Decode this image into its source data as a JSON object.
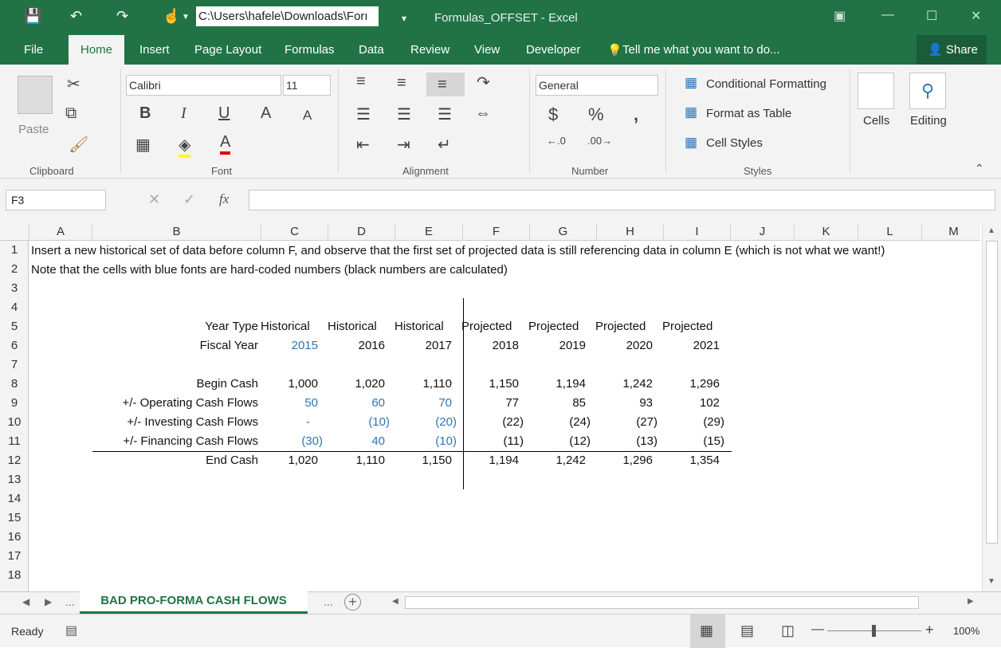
{
  "title_bar": {
    "path": "C:\\Users\\hafele\\Downloads\\Forı",
    "window_title": "Formulas_OFFSET - Excel"
  },
  "tabs": [
    "File",
    "Home",
    "Insert",
    "Page Layout",
    "Formulas",
    "Data",
    "Review",
    "View",
    "Developer"
  ],
  "tell_me": "Tell me what you want to do...",
  "share": "Share",
  "ribbon": {
    "paste": "Paste",
    "font_name": "Calibri",
    "font_size": "11",
    "number_format": "General",
    "conditional_formatting": "Conditional Formatting",
    "format_as_table": "Format as Table",
    "cell_styles": "Cell Styles",
    "cells": "Cells",
    "editing": "Editing",
    "groups": {
      "clipboard": "Clipboard",
      "font": "Font",
      "alignment": "Alignment",
      "number": "Number",
      "styles": "Styles"
    }
  },
  "formula_bar": {
    "name_box": "F3",
    "fx": "fx",
    "formula": ""
  },
  "columns": [
    "A",
    "B",
    "C",
    "D",
    "E",
    "F",
    "G",
    "H",
    "I",
    "J",
    "K",
    "L",
    "M"
  ],
  "rows": [
    "1",
    "2",
    "3",
    "4",
    "5",
    "6",
    "7",
    "8",
    "9",
    "10",
    "11",
    "12",
    "13",
    "14",
    "15",
    "16",
    "17",
    "18"
  ],
  "sheet": {
    "note1": "Insert a new historical set of data before column F, and observe that the first set of projected data is still referencing data in column E (which is not what we want!)",
    "note2": "Note that the cells with blue fonts are hard-coded numbers (black numbers are calculated)",
    "year_type_label": "Year Type",
    "year_types": [
      "Historical",
      "Historical",
      "Historical",
      "Projected",
      "Projected",
      "Projected",
      "Projected"
    ],
    "fiscal_year_label": "Fiscal Year",
    "fiscal_years": [
      "2015",
      "2016",
      "2017",
      "2018",
      "2019",
      "2020",
      "2021"
    ],
    "begin_cash_label": "Begin Cash",
    "begin_cash": [
      "1,000",
      "1,020",
      "1,110",
      "1,150",
      "1,194",
      "1,242",
      "1,296"
    ],
    "operating_label": "+/- Operating Cash Flows",
    "operating": [
      "50",
      "60",
      "70",
      "77",
      "85",
      "93",
      "102"
    ],
    "investing_label": "+/- Investing Cash Flows",
    "investing": [
      "-",
      "(10)",
      "(20)",
      "(22)",
      "(24)",
      "(27)",
      "(29)"
    ],
    "financing_label": "+/- Financing Cash Flows",
    "financing": [
      "(30)",
      "40",
      "(10)",
      "(11)",
      "(12)",
      "(13)",
      "(15)"
    ],
    "end_cash_label": "End Cash",
    "end_cash": [
      "1,020",
      "1,110",
      "1,150",
      "1,194",
      "1,242",
      "1,296",
      "1,354"
    ]
  },
  "sheet_tab": "BAD PRO-FORMA CASH FLOWS",
  "status": {
    "ready": "Ready",
    "zoom": "100%"
  },
  "colors": {
    "accent": "#217346",
    "hardcoded_blue": "#2e75b6"
  }
}
